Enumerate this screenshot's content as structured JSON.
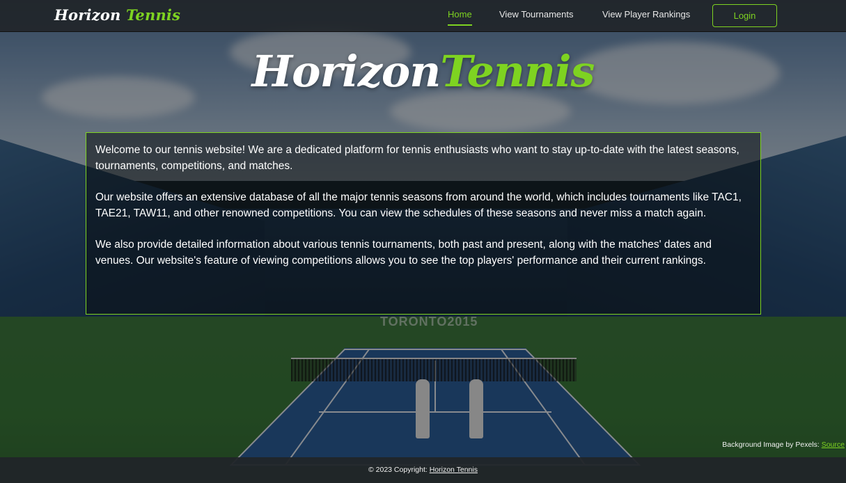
{
  "navbar": {
    "brand_part1": "Horizon",
    "brand_part2": "Tennis",
    "links": [
      {
        "label": "Home"
      },
      {
        "label": "View Tournaments"
      },
      {
        "label": "View Player Rankings"
      }
    ],
    "login_label": "Login"
  },
  "hero": {
    "title_part1": "Horizon",
    "title_part2": "Tennis"
  },
  "info": {
    "paragraphs": [
      "Welcome to our tennis website! We are a dedicated platform for tennis enthusiasts who want to stay up-to-date with the latest seasons, tournaments, competitions, and matches.",
      "Our website offers an extensive database of all the major tennis seasons from around the world, which includes tournaments like TAC1, TAE21, TAW11, and other renowned competitions. You can view the schedules of these seasons and never miss a match again.",
      "We also provide detailed information about various tennis tournaments, both past and present, along with the matches' dates and venues. Our website's feature of viewing competitions allows you to see the top players' performance and their current rankings."
    ]
  },
  "background": {
    "sign_text": "TORONTO2015"
  },
  "credit": {
    "text": "Background Image by Pexels:",
    "link_label": "Source"
  },
  "footer": {
    "text": "© 2023 Copyright:",
    "link_label": "Horizon Tennis"
  },
  "colors": {
    "accent": "#7ed321",
    "navbar_bg": "#212529"
  }
}
